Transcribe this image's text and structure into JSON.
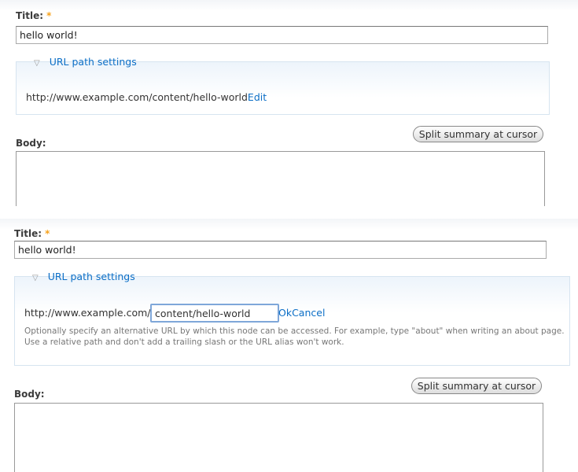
{
  "panels": [
    {
      "title_label": "Title:",
      "required_mark": "*",
      "title_value": "hello world!",
      "fieldset_legend": "URL path settings",
      "url": "http://www.example.com/content/hello-world",
      "edit_link": "Edit",
      "split_button": "Split summary at cursor",
      "body_label": "Body:"
    },
    {
      "title_label": "Title:",
      "required_mark": "*",
      "title_value": "hello world!",
      "fieldset_legend": "URL path settings",
      "url_prefix": "http://www.example.com/",
      "alias_value": "content/hello-world",
      "ok_link": "Ok",
      "cancel_link": "Cancel",
      "description": "Optionally specify an alternative URL by which this node can be accessed. For example, type \"about\" when writing an about page. Use a relative path and don't add a trailing slash or the URL alias won't work.",
      "split_button": "Split summary at cursor",
      "body_label": "Body:"
    }
  ]
}
